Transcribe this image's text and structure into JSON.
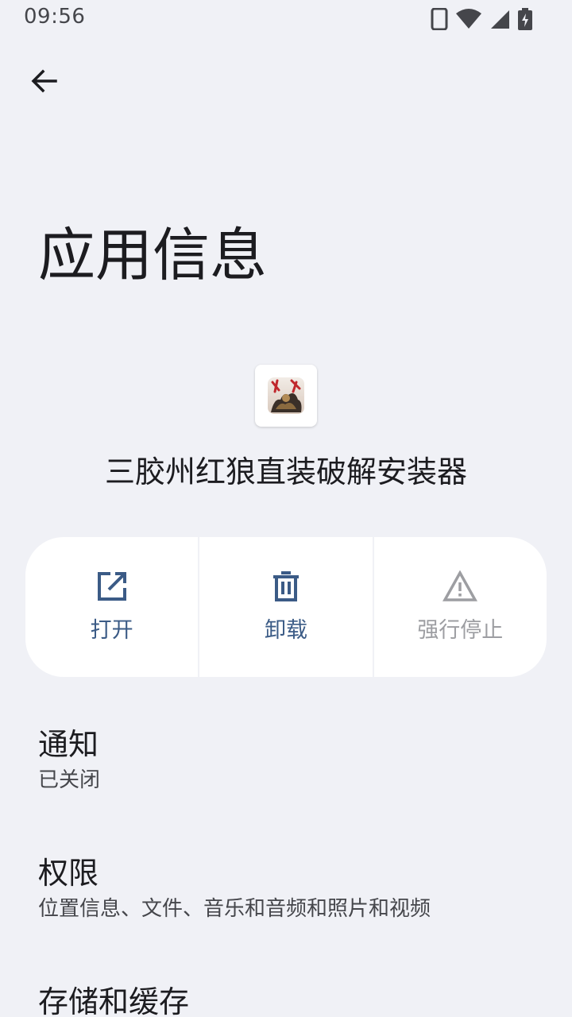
{
  "status_bar": {
    "time": "09:56",
    "icons": [
      "phone-icon",
      "wifi-icon",
      "signal-icon",
      "battery-charging-icon"
    ]
  },
  "header": {
    "back_icon": "arrow-back-icon",
    "title": "应用信息"
  },
  "app": {
    "name": "三胶州红狼直装破解安装器"
  },
  "actions": [
    {
      "label": "打开",
      "icon": "open-external-icon",
      "enabled": true
    },
    {
      "label": "卸载",
      "icon": "trash-icon",
      "enabled": true
    },
    {
      "label": "强行停止",
      "icon": "warning-icon",
      "enabled": false
    }
  ],
  "settings": [
    {
      "title": "通知",
      "summary": "已关闭"
    },
    {
      "title": "权限",
      "summary": "位置信息、文件、音乐和音频和照片和视频"
    },
    {
      "title": "存储和缓存",
      "summary": ""
    }
  ],
  "colors": {
    "background": "#f0f1f6",
    "card": "#ffffff",
    "accent": "#3b5b86",
    "disabled": "#9d9ea2",
    "text_primary": "#1c1c20",
    "text_secondary": "#45464b"
  }
}
